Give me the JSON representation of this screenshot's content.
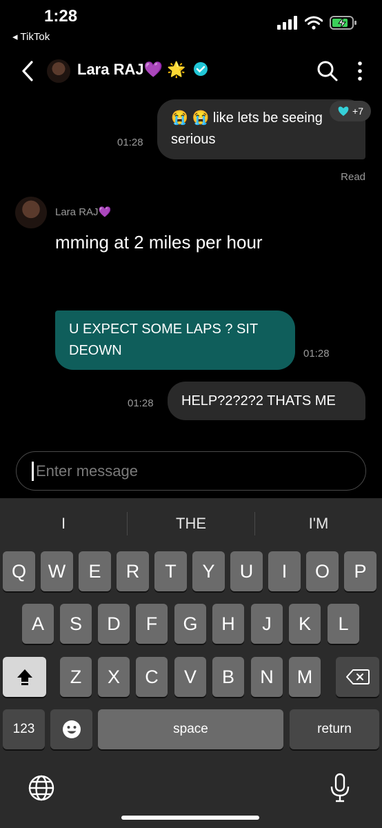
{
  "status": {
    "time": "1:28",
    "back_app": "◂ TikTok"
  },
  "header": {
    "name": "Lara RAJ",
    "emoji": "💜 🌟"
  },
  "messages": {
    "m1_line1": "😭 😭  like lets be seeing",
    "m1_line2": "serious",
    "m1_time": "01:28",
    "reaction_count": "+7",
    "read": "Read",
    "sender_name": "Lara RAJ",
    "sender_emoji": "💜",
    "m2_text": "mming at 2 miles per hour",
    "m3_line1": "U EXPECT SOME LAPS ? SIT",
    "m3_line2": "DEOWN",
    "m3_time": "01:28",
    "m4_text": "HELP?2?2?2 THATS ME",
    "m4_time": "01:28"
  },
  "input": {
    "placeholder": "Enter message"
  },
  "keyboard": {
    "suggestions": [
      "I",
      "THE",
      "I'M"
    ],
    "row1": [
      "Q",
      "W",
      "E",
      "R",
      "T",
      "Y",
      "U",
      "I",
      "O",
      "P"
    ],
    "row2": [
      "A",
      "S",
      "D",
      "F",
      "G",
      "H",
      "J",
      "K",
      "L"
    ],
    "row3": [
      "Z",
      "X",
      "C",
      "V",
      "B",
      "N",
      "M"
    ],
    "numbers": "123",
    "space": "space",
    "return": "return"
  },
  "colors": {
    "teal_bubble": "#0f5e5b",
    "dark_bubble": "#2a2a2a",
    "verified": "#20c6d6"
  }
}
